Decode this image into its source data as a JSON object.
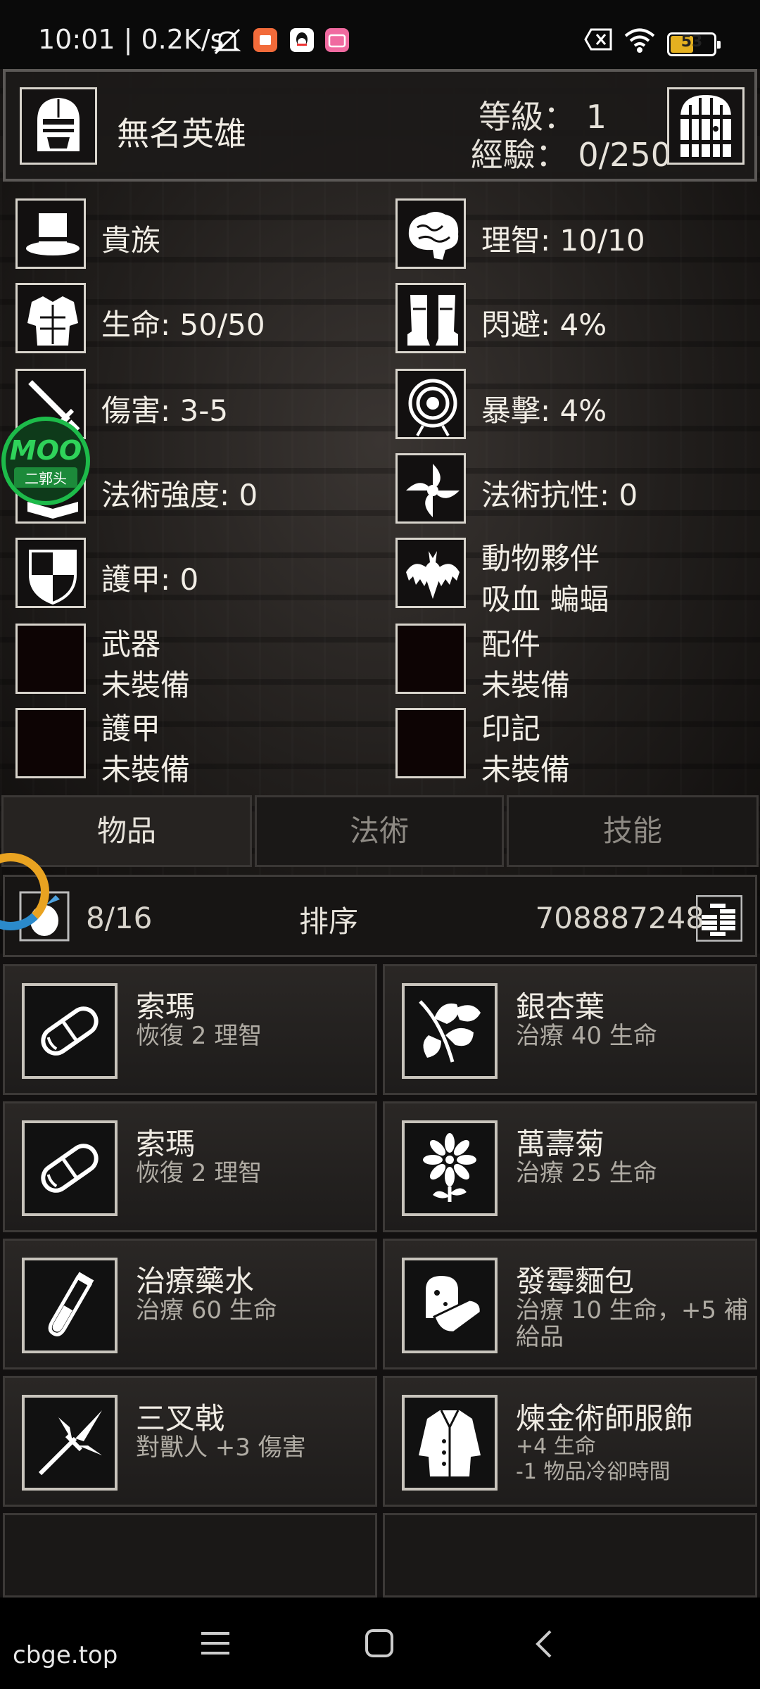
{
  "status_bar": {
    "time": "10:01 | 0.2K/s",
    "battery": "53",
    "battery_level": 0.53,
    "icons": [
      "mute-icon",
      "app-notification-icon",
      "qq-icon",
      "bilibili-icon",
      "close-box-icon",
      "wifi-icon",
      "battery-icon"
    ]
  },
  "hero": {
    "name": "無名英雄",
    "level_label": "等級：  1",
    "xp_label": "經驗：  0/250",
    "portrait_icon": "knight-helmet-icon",
    "exit_icon": "dungeon-door-icon"
  },
  "stats": {
    "class": "貴族",
    "sanity": "理智: 10/10",
    "life": "生命: 50/50",
    "dodge": "閃避: 4%",
    "damage": "傷害: 3-5",
    "crit": "暴擊: 4%",
    "spell_power": "法術強度: 0",
    "spell_resist": "法術抗性: 0",
    "armor": "護甲: 0",
    "pet_label": "動物夥伴",
    "pet_name": "吸血 蝙蝠"
  },
  "equipment": {
    "weapon_label": "武器",
    "weapon_value": "未裝備",
    "accessory_label": "配件",
    "accessory_value": "未裝備",
    "armor_label": "護甲",
    "armor_value": "未裝備",
    "sigil_label": "印記",
    "sigil_value": "未裝備"
  },
  "tabs": [
    {
      "label": "物品",
      "active": true
    },
    {
      "label": "法術",
      "active": false
    },
    {
      "label": "技能",
      "active": false
    }
  ],
  "inventory": {
    "bag_count": "8/16",
    "sort_label": "排序",
    "gold": "708887248"
  },
  "items": [
    {
      "name": "索瑪",
      "desc": "恢復 2 理智",
      "icon": "pill-capsule-icon"
    },
    {
      "name": "銀杏葉",
      "desc": "治療 40 生命",
      "icon": "ginkgo-leaf-icon"
    },
    {
      "name": "索瑪",
      "desc": "恢復 2 理智",
      "icon": "pill-capsule-icon"
    },
    {
      "name": "萬壽菊",
      "desc": "治療 25 生命",
      "icon": "marigold-flower-icon"
    },
    {
      "name": "治療藥水",
      "desc": "治療 60 生命",
      "icon": "potion-vial-icon"
    },
    {
      "name": "發霉麵包",
      "desc": "治療 10 生命，+5 補給品",
      "icon": "moldy-bread-icon"
    },
    {
      "name": "三叉戟",
      "desc": "對獸人 +3 傷害",
      "icon": "trident-icon"
    },
    {
      "name": "煉金術師服飾",
      "desc": "+4 生命\n-1 物品冷卻時間",
      "icon": "alchemist-coat-icon"
    }
  ],
  "watermark": {
    "badge_top": "MOO",
    "badge_bottom": "二郭头",
    "site": "cbge.top"
  }
}
